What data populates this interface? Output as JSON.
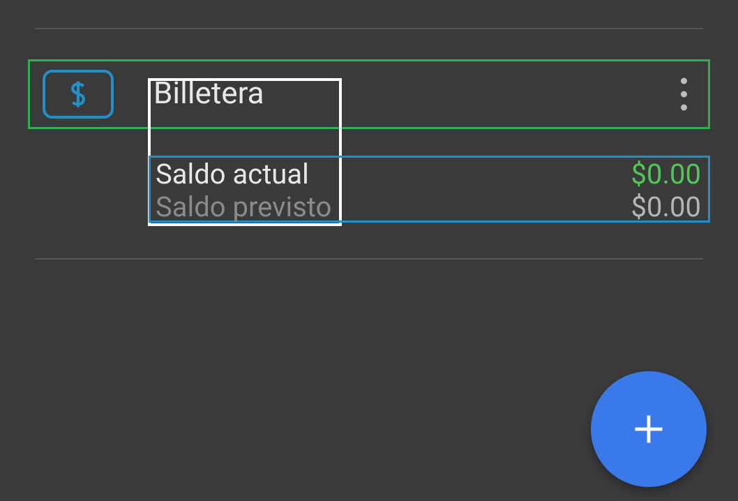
{
  "wallet": {
    "title": "Billetera",
    "icon": "dollar-icon",
    "current_balance_label": "Saldo actual",
    "current_balance_value": "$0.00",
    "expected_balance_label": "Saldo previsto",
    "expected_balance_value": "$0.00"
  },
  "colors": {
    "accent_green": "#2eb050",
    "accent_blue": "#2190c9",
    "positive_value": "#4ec957",
    "fab": "#3a79ea"
  }
}
